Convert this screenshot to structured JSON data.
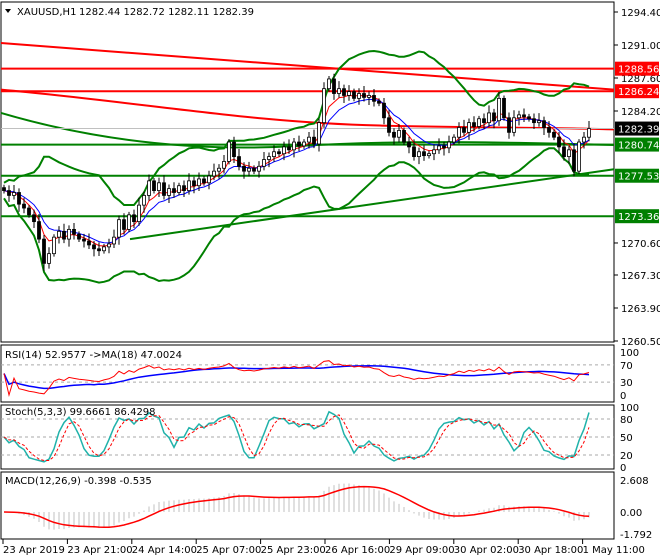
{
  "header": {
    "symbol": "XAUUSD,H1",
    "ohlc": "1282.44 1282.72 1282.11 1282.39"
  },
  "colors": {
    "bull": "#ffffff",
    "bear": "#000000",
    "red": "#ff0000",
    "green": "#008000",
    "blue": "#0000ff",
    "teal": "#20b2aa",
    "hist": "#c0c0c0"
  },
  "chart_data": {
    "type": "candlestick",
    "symbol": "XAUUSD",
    "timeframe": "H1",
    "ylim": [
      1260.5,
      1294.4
    ],
    "y_ticks": [
      "1294.40",
      "1291.00",
      "1287.60",
      "1284.20",
      "1270.60",
      "1267.30",
      "1263.90",
      "1260.50"
    ],
    "price_tags": [
      {
        "label": "1288.56",
        "value": 1288.56,
        "color": "#ff0000"
      },
      {
        "label": "1286.24",
        "value": 1286.24,
        "color": "#ff0000"
      },
      {
        "label": "1282.39",
        "value": 1282.39,
        "color": "#000000"
      },
      {
        "label": "1280.74",
        "value": 1280.74,
        "color": "#008000"
      },
      {
        "label": "1277.53",
        "value": 1277.53,
        "color": "#008000"
      },
      {
        "label": "1273.36",
        "value": 1273.36,
        "color": "#008000"
      }
    ],
    "x_ticks": [
      "23 Apr 2019",
      "23 Apr 21:00",
      "24 Apr 14:00",
      "25 Apr 07:00",
      "25 Apr 23:00",
      "26 Apr 16:00",
      "29 Apr 09:00",
      "30 Apr 02:00",
      "30 Apr 18:00",
      "1 May 11:00"
    ],
    "closes": [
      1276.0,
      1275.5,
      1275.8,
      1274.6,
      1274.2,
      1273.5,
      1272.8,
      1271.0,
      1268.5,
      1269.5,
      1271.2,
      1271.8,
      1271.0,
      1272.0,
      1271.5,
      1271.0,
      1270.8,
      1270.4,
      1270.0,
      1269.8,
      1270.2,
      1270.5,
      1271.2,
      1273.0,
      1272.0,
      1273.5,
      1272.8,
      1274.5,
      1275.5,
      1277.0,
      1276.0,
      1276.8,
      1275.5,
      1276.2,
      1275.8,
      1276.5,
      1276.0,
      1277.0,
      1276.5,
      1277.2,
      1276.8,
      1277.5,
      1278.0,
      1278.3,
      1279.0,
      1281.0,
      1279.5,
      1278.5,
      1278.0,
      1278.3,
      1278.0,
      1278.5,
      1279.2,
      1279.5,
      1280.0,
      1279.8,
      1280.5,
      1280.2,
      1281.0,
      1280.6,
      1281.0,
      1281.5,
      1280.8,
      1283.0,
      1286.5,
      1287.5,
      1286.0,
      1286.5,
      1285.8,
      1286.2,
      1285.5,
      1286.0,
      1285.6,
      1285.8,
      1285.2,
      1285.0,
      1283.5,
      1282.0,
      1281.5,
      1282.2,
      1281.0,
      1280.5,
      1279.5,
      1280.0,
      1279.6,
      1279.8,
      1280.2,
      1280.6,
      1280.4,
      1281.0,
      1281.5,
      1282.5,
      1282.0,
      1283.0,
      1282.6,
      1283.4,
      1283.0,
      1284.0,
      1283.2,
      1285.5,
      1283.5,
      1282.0,
      1283.5,
      1283.8,
      1283.6,
      1283.4,
      1283.0,
      1283.2,
      1282.5,
      1282.0,
      1281.5,
      1280.5,
      1279.5,
      1280.2,
      1278.0,
      1281.0,
      1281.5,
      1282.39
    ],
    "indicators": {
      "rsi": {
        "label": "RSI(14) 52.9577  ->MA(18) 47.0024",
        "levels": [
          "100",
          "70",
          "30",
          "0"
        ]
      },
      "stoch": {
        "label": "Stoch(5,3,3) 99.6661 86.4298",
        "levels": [
          "100",
          "80",
          "50",
          "20",
          "0"
        ]
      },
      "macd": {
        "label": "MACD(12,26,9) -0.398 -0.535",
        "levels": [
          "2.608",
          "0.00",
          "-1.792"
        ]
      }
    }
  }
}
